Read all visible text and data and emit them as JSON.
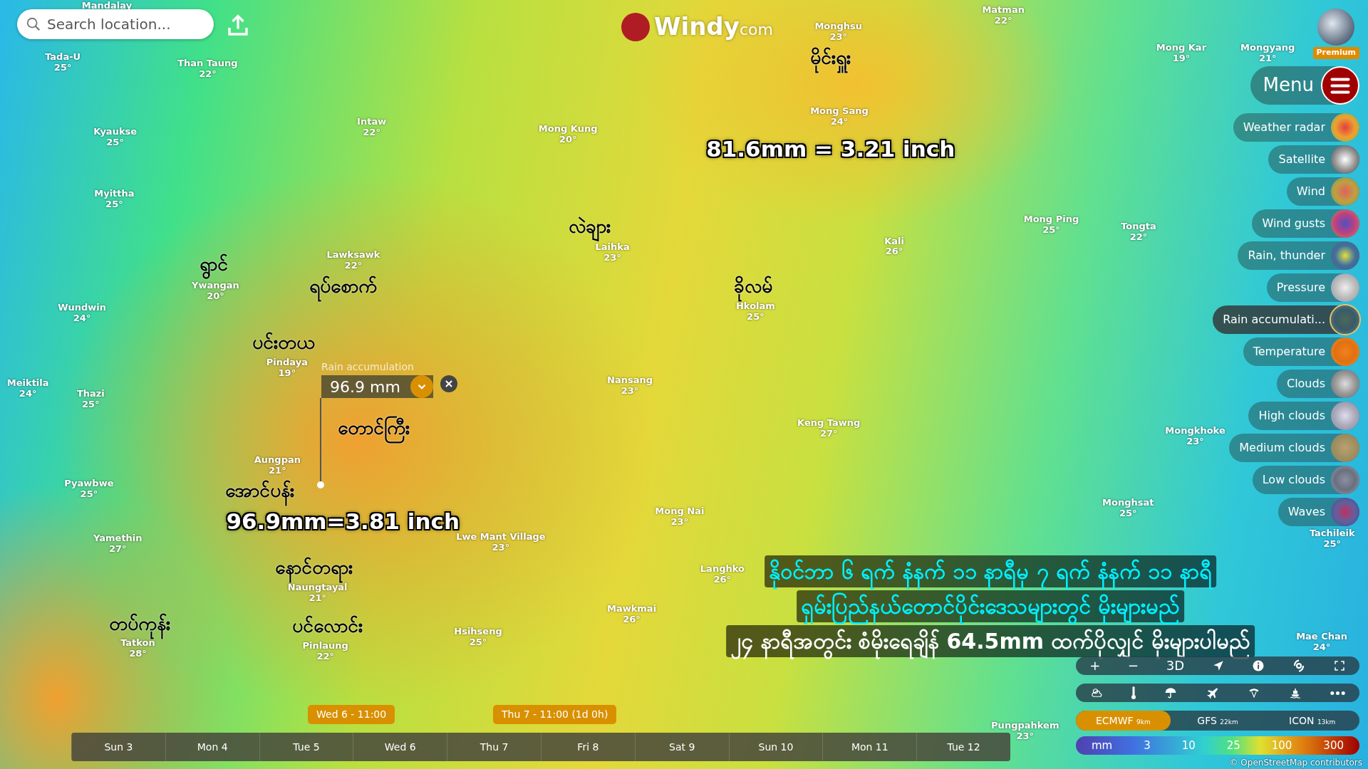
{
  "search": {
    "placeholder": "Search location..."
  },
  "logo": {
    "name": "Windy",
    "suffix": "com"
  },
  "account": {
    "badge": "Premium"
  },
  "menu": {
    "label": "Menu"
  },
  "layers": [
    {
      "label": "Weather radar",
      "selected": false
    },
    {
      "label": "Satellite",
      "selected": false
    },
    {
      "label": "Wind",
      "selected": false
    },
    {
      "label": "Wind gusts",
      "selected": false
    },
    {
      "label": "Rain, thunder",
      "selected": false
    },
    {
      "label": "Pressure",
      "selected": false
    },
    {
      "label": "Rain accumulati...",
      "selected": true
    },
    {
      "label": "Temperature",
      "selected": false
    },
    {
      "label": "Clouds",
      "selected": false
    },
    {
      "label": "High clouds",
      "selected": false
    },
    {
      "label": "Medium clouds",
      "selected": false
    },
    {
      "label": "Low clouds",
      "selected": false
    },
    {
      "label": "Waves",
      "selected": false
    }
  ],
  "cities": [
    {
      "name": "Mandalay"
    },
    {
      "name": "Tada-U",
      "temp": "25°"
    },
    {
      "name": "Than Taung",
      "temp": "22°"
    },
    {
      "name": "Kyaukse",
      "temp": "25°"
    },
    {
      "name": "Myittha",
      "temp": "25°"
    },
    {
      "name": "Intaw",
      "temp": "22°"
    },
    {
      "name": "Mong Kung",
      "temp": "20°"
    },
    {
      "name": "Monghsu",
      "temp": "23°"
    },
    {
      "name": "Mong Sang",
      "temp": "24°"
    },
    {
      "name": "Matman",
      "temp": "22°"
    },
    {
      "name": "Mong Kar",
      "temp": "19°"
    },
    {
      "name": "Mongyang",
      "temp": "21°"
    },
    {
      "name": "Lawksawk",
      "temp": "22°"
    },
    {
      "name": "Ywangan",
      "temp": "20°"
    },
    {
      "name": "Wundwin",
      "temp": "24°"
    },
    {
      "name": "Laihka",
      "temp": "23°"
    },
    {
      "name": "Hkolam",
      "temp": "25°"
    },
    {
      "name": "Kali",
      "temp": "26°"
    },
    {
      "name": "Mong Ping",
      "temp": "25°"
    },
    {
      "name": "Tongta",
      "temp": "22°"
    },
    {
      "name": "Pindaya",
      "temp": "19°"
    },
    {
      "name": "Meiktila",
      "temp": "24°"
    },
    {
      "name": "Thazi",
      "temp": "25°"
    },
    {
      "name": "Nansang",
      "temp": "23°"
    },
    {
      "name": "Aungpan",
      "temp": "21°"
    },
    {
      "name": "Keng Tawng",
      "temp": "27°"
    },
    {
      "name": "Mongkhoke",
      "temp": "23°"
    },
    {
      "name": "Pyawbwe",
      "temp": "25°"
    },
    {
      "name": "Mong Nai",
      "temp": "23°"
    },
    {
      "name": "Lwe Mant Village",
      "temp": "23°"
    },
    {
      "name": "Monghsat",
      "temp": "25°"
    },
    {
      "name": "Yamethin",
      "temp": "27°"
    },
    {
      "name": "Tachileik",
      "temp": "25°"
    },
    {
      "name": "Langhko",
      "temp": "26°"
    },
    {
      "name": "Naungtayal",
      "temp": "21°"
    },
    {
      "name": "Mawkmai",
      "temp": "26°"
    },
    {
      "name": "Tatkon",
      "temp": "28°"
    },
    {
      "name": "Hsihseng",
      "temp": "25°"
    },
    {
      "name": "Pinlaung",
      "temp": "22°"
    },
    {
      "name": "Mae Chan",
      "temp": "24°"
    },
    {
      "name": "Pungpahkem",
      "temp": "23°"
    }
  ],
  "local_names": [
    {
      "text": "မိုင်းရှူး"
    },
    {
      "text": "လဲချား"
    },
    {
      "text": "ရွာင်"
    },
    {
      "text": "ရပ်စောက်"
    },
    {
      "text": "ခိုလမ်"
    },
    {
      "text": "ပင်းတယ"
    },
    {
      "text": "တောင်ကြီး"
    },
    {
      "text": "အောင်ပန်း"
    },
    {
      "text": "နောင်တရား"
    },
    {
      "text": "တပ်ကုန်း"
    },
    {
      "text": "ပင်လောင်း"
    }
  ],
  "callouts": [
    {
      "text": "81.6mm = 3.21 inch"
    },
    {
      "text": "96.9mm=3.81 inch"
    }
  ],
  "popup": {
    "title": "Rain accumulation",
    "value": "96.9 mm"
  },
  "notice": [
    {
      "text": "နိုဝင်ဘာ ၆ ရက် နံနက် ၁၁ နာရီမှ ၇ ရက် နံနက် ၁၁ နာရီ",
      "kind": "headline"
    },
    {
      "text": "ရှမ်းပြည်နယ်တောင်ပိုင်းဒေသများတွင် မိုးများမည်",
      "kind": "headline"
    },
    {
      "text": "၂၄ နာရီအတွင်း စံမိုးရေချိန် 64.5mm ထက်ပိုလျှင် မိုးများပါမည်",
      "kind": "detail"
    }
  ],
  "controls": {
    "zoom_in": "+",
    "zoom_out": "−",
    "mode": "3D"
  },
  "models": [
    {
      "name": "ECMWF",
      "resolution": "9km",
      "selected": true
    },
    {
      "name": "GFS",
      "resolution": "22km",
      "selected": false
    },
    {
      "name": "ICON",
      "resolution": "13km",
      "selected": false
    }
  ],
  "legend": {
    "unit": "mm",
    "stops": [
      "3",
      "10",
      "25",
      "100",
      "300"
    ]
  },
  "attribution": "© OpenStreetMap contributors",
  "timeline": {
    "days": [
      "Sun 3",
      "Mon 4",
      "Tue 5",
      "Wed 6",
      "Thu 7",
      "Fri 8",
      "Sat 9",
      "Sun 10",
      "Mon 11",
      "Tue 12"
    ],
    "markers": [
      {
        "label": "Wed 6 - 11:00"
      },
      {
        "label": "Thu 7 - 11:00 (1d 0h)"
      }
    ]
  }
}
